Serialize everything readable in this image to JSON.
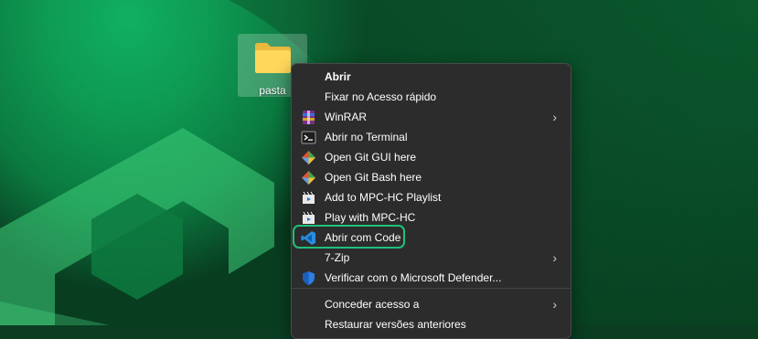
{
  "desktop": {
    "icons": [
      {
        "label": "pasta",
        "icon": "folder-icon"
      }
    ]
  },
  "context_menu": {
    "items": [
      {
        "label": "Abrir",
        "bold": true,
        "icon": "",
        "submenu": false
      },
      {
        "label": "Fixar no Acesso rápido",
        "icon": "",
        "submenu": false
      },
      {
        "label": "WinRAR",
        "icon": "winrar-icon",
        "submenu": true
      },
      {
        "label": "Abrir no Terminal",
        "icon": "terminal-icon",
        "submenu": false
      },
      {
        "label": "Open Git GUI here",
        "icon": "git-icon",
        "submenu": false
      },
      {
        "label": "Open Git Bash here",
        "icon": "git-icon",
        "submenu": false
      },
      {
        "label": "Add to MPC-HC Playlist",
        "icon": "mpc-hc-icon",
        "submenu": false
      },
      {
        "label": "Play with MPC-HC",
        "icon": "mpc-hc-icon",
        "submenu": false
      },
      {
        "label": "Abrir com Code",
        "icon": "vscode-icon",
        "submenu": false,
        "highlighted": true
      },
      {
        "label": "7-Zip",
        "icon": "",
        "submenu": true
      },
      {
        "label": "Verificar com o Microsoft Defender...",
        "icon": "defender-icon",
        "submenu": false
      },
      {
        "label": "Conceder acesso a",
        "icon": "",
        "submenu": true
      },
      {
        "label": "Restaurar versões anteriores",
        "icon": "",
        "submenu": false
      }
    ],
    "submenu_glyph": "›",
    "highlight_color": "#20c07a"
  }
}
